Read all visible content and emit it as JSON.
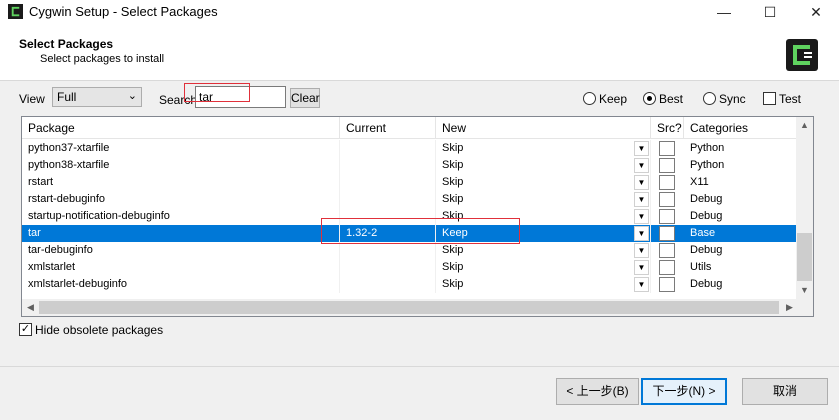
{
  "window": {
    "title": "Cygwin Setup - Select Packages",
    "minimize": "—",
    "maximize": "☐",
    "close": "✕"
  },
  "header": {
    "title": "Select Packages",
    "subtitle": "Select packages to install"
  },
  "controls": {
    "view_label": "View",
    "view_value": "Full",
    "search_label": "Search",
    "search_value": "tar",
    "clear_label": "Clear",
    "radio_keep": "Keep",
    "radio_best": "Best",
    "radio_sync": "Sync",
    "test_label": "Test",
    "selected_mode": "Best"
  },
  "grid": {
    "columns": [
      "Package",
      "Current",
      "New",
      "Src?",
      "Categories"
    ],
    "rows": [
      {
        "package": "python37-xtarfile",
        "current": "",
        "new": "Skip",
        "category": "Python"
      },
      {
        "package": "python38-xtarfile",
        "current": "",
        "new": "Skip",
        "category": "Python"
      },
      {
        "package": "rstart",
        "current": "",
        "new": "Skip",
        "category": "X11"
      },
      {
        "package": "rstart-debuginfo",
        "current": "",
        "new": "Skip",
        "category": "Debug"
      },
      {
        "package": "startup-notification-debuginfo",
        "current": "",
        "new": "Skip",
        "category": "Debug"
      },
      {
        "package": "tar",
        "current": "1.32-2",
        "new": "Keep",
        "category": "Base"
      },
      {
        "package": "tar-debuginfo",
        "current": "",
        "new": "Skip",
        "category": "Debug"
      },
      {
        "package": "xmlstarlet",
        "current": "",
        "new": "Skip",
        "category": "Utils"
      },
      {
        "package": "xmlstarlet-debuginfo",
        "current": "",
        "new": "Skip",
        "category": "Debug"
      }
    ],
    "selected_index": 5
  },
  "footer": {
    "hide_obsolete_label": "Hide obsolete packages",
    "back_label": "< 上一步(B)",
    "next_label": "下一步(N) >",
    "cancel_label": "取消"
  },
  "colors": {
    "selection": "#0078d7",
    "highlight_box": "#e0303a"
  }
}
